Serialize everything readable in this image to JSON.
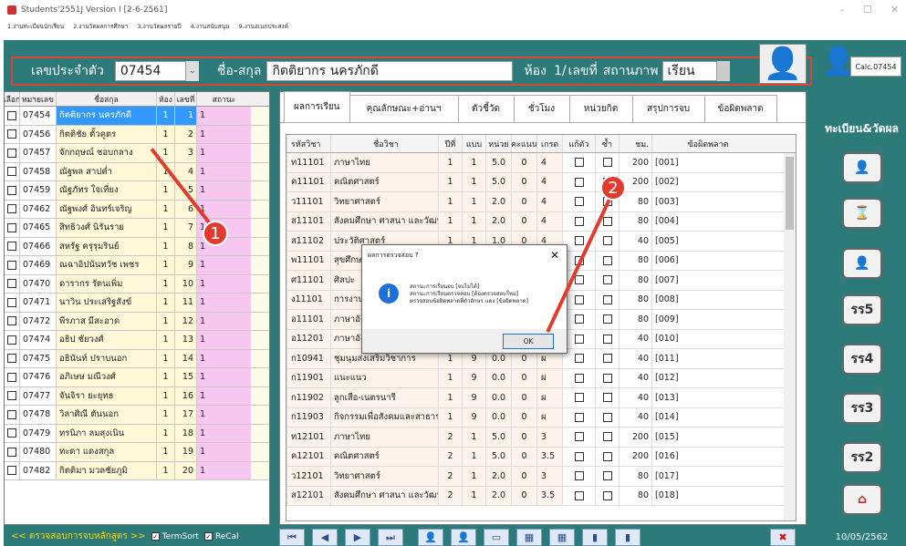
{
  "window": {
    "title": "Students'2551J Version I [2-6-2561]"
  },
  "menu": [
    "1.งานทะเบียนนักเรียน",
    "2.งานวัดผลการศึกษา",
    "3.งานวัดผลรายปี",
    "4.งานสนับสนุน",
    "9.งานอเนกประสงค์"
  ],
  "header": {
    "id_label": "เลขประจำตัว",
    "id_value": "07454",
    "name_label": "ชื่อ-สกุล",
    "name_value": "กิตติยากร นครภักดี",
    "room_label": "ห้อง",
    "room_value": "1/",
    "no_label": "เลขที่",
    "status_label": "สถานภาพ",
    "status_value": "เรียน"
  },
  "right": {
    "calc_label": "Calc.07454",
    "section_title": "ทะเบียน&วัดผล",
    "buttons": [
      "รร5",
      "รร4",
      "รร3",
      "รร2"
    ],
    "date": "10/05/2562"
  },
  "left_grid": {
    "headers": [
      "เลือก",
      "หมายเลข",
      "ชื่อสกุล",
      "ห้อง",
      "เลขที่",
      "สถานะ"
    ],
    "rows": [
      {
        "id": "07454",
        "name": "กิตติยากร นครภักดี",
        "room": "1",
        "no": "1",
        "status": "1"
      },
      {
        "id": "07456",
        "name": "กิตติชัย ตั้วคูตร",
        "room": "1",
        "no": "2",
        "status": "1"
      },
      {
        "id": "07457",
        "name": "จักกฤษณ์ ชอบกลาง",
        "room": "1",
        "no": "3",
        "status": "1"
      },
      {
        "id": "07458",
        "name": "ณัฐพล สาปค่ำ",
        "room": "1",
        "no": "4",
        "status": "1"
      },
      {
        "id": "07459",
        "name": "ณัฐภัทร ใจเที่ยง",
        "room": "1",
        "no": "5",
        "status": "1"
      },
      {
        "id": "07462",
        "name": "ณัฐพงศ์ อินทร์เจริญ",
        "room": "1",
        "no": "6",
        "status": "1"
      },
      {
        "id": "07465",
        "name": "สิทธิวงศ์ นิรันราย",
        "room": "1",
        "no": "7",
        "status": "1"
      },
      {
        "id": "07466",
        "name": "สหรัฐ ครุรุมรินย์",
        "room": "1",
        "no": "8",
        "status": "1"
      },
      {
        "id": "07469",
        "name": "ณฉาอิปนันทวัช เพชร",
        "room": "1",
        "no": "9",
        "status": "1"
      },
      {
        "id": "07470",
        "name": "ดารากร รัตนเพิ่ม",
        "room": "1",
        "no": "10",
        "status": "1"
      },
      {
        "id": "07471",
        "name": "นาวิน ประเสริฐสังข์",
        "room": "1",
        "no": "11",
        "status": "1"
      },
      {
        "id": "07472",
        "name": "พีรภาส มีสะอาด",
        "room": "1",
        "no": "12",
        "status": "1"
      },
      {
        "id": "07474",
        "name": "อธิป ชัยวงศ์",
        "room": "1",
        "no": "13",
        "status": "1"
      },
      {
        "id": "07475",
        "name": "อธินันท์ ปราบนอก",
        "room": "1",
        "no": "14",
        "status": "1"
      },
      {
        "id": "07476",
        "name": "อภิเษษ มณีวงศ์",
        "room": "1",
        "no": "15",
        "status": "1"
      },
      {
        "id": "07477",
        "name": "จันจิรา ยะยุทธ",
        "room": "1",
        "no": "16",
        "status": "1"
      },
      {
        "id": "07478",
        "name": "วิลาศิณี ตันนอก",
        "room": "1",
        "no": "17",
        "status": "1"
      },
      {
        "id": "07479",
        "name": "ทรนิภา ลมสุงเนิน",
        "room": "1",
        "no": "18",
        "status": "1"
      },
      {
        "id": "07480",
        "name": "ทะดา แดงสกุล",
        "room": "1",
        "no": "19",
        "status": "1"
      },
      {
        "id": "07482",
        "name": "กิตติมา มวลชัยภูมิ",
        "room": "1",
        "no": "20",
        "status": "1"
      }
    ]
  },
  "tabs": [
    "ผลการเรียน",
    "คุณลักษณะ+อ่านฯ",
    "ตัวชี้วัด",
    "ชั่วโมง",
    "หน่วยกิต",
    "สรุปการจบ",
    "ข้อผิดพลาด"
  ],
  "grid": {
    "headers": [
      "รหัสวิชา",
      "ชื่อวิชา",
      "ปีที่",
      "แบบ",
      "หน่วย",
      "คะแนน",
      "เกรด",
      "แก้ตัว",
      "ซ้ำ",
      "ชม.",
      "ข้อผิดพลาด"
    ],
    "rows": [
      {
        "code": "ท11101",
        "name": "ภาษาไทย",
        "yr": "1",
        "type": "1",
        "unit": "5.0",
        "score": "0",
        "grade": "4",
        "hrs": "200",
        "err": "[001]"
      },
      {
        "code": "ค11101",
        "name": "คณิตศาสตร์",
        "yr": "1",
        "type": "1",
        "unit": "5.0",
        "score": "0",
        "grade": "4",
        "hrs": "200",
        "err": "[002]"
      },
      {
        "code": "ว11101",
        "name": "วิทยาศาสตร์",
        "yr": "1",
        "type": "1",
        "unit": "2.0",
        "score": "0",
        "grade": "4",
        "hrs": "80",
        "err": "[003]"
      },
      {
        "code": "ส11101",
        "name": "สังคมศึกษา ศาสนา และวัฒนธ",
        "yr": "1",
        "type": "1",
        "unit": "2.0",
        "score": "0",
        "grade": "4",
        "hrs": "80",
        "err": "[004]"
      },
      {
        "code": "ส11102",
        "name": "ประวัติศาสตร์",
        "yr": "1",
        "type": "1",
        "unit": "1.0",
        "score": "0",
        "grade": "4",
        "hrs": "40",
        "err": "[005]"
      },
      {
        "code": "พ11101",
        "name": "สุขศึกษาและพลศึกษา",
        "yr": "1",
        "type": "1",
        "unit": "2.0",
        "score": "0",
        "grade": "4",
        "hrs": "80",
        "err": "[006]"
      },
      {
        "code": "ศ11101",
        "name": "ศิลปะ",
        "yr": "1",
        "type": "1",
        "unit": "2.0",
        "score": "0",
        "grade": "4",
        "hrs": "80",
        "err": "[007]"
      },
      {
        "code": "ง11101",
        "name": "การงานอาชีพ",
        "yr": "1",
        "type": "1",
        "unit": "2.0",
        "score": "0",
        "grade": "4",
        "hrs": "80",
        "err": "[008]"
      },
      {
        "code": "อ11101",
        "name": "ภาษาอังกฤษ",
        "yr": "1",
        "type": "1",
        "unit": "2.0",
        "score": "0",
        "grade": "3.5",
        "hrs": "80",
        "err": "[009]"
      },
      {
        "code": "อ11201",
        "name": "ภาษาอังกฤษเพิ่มเติม",
        "yr": "1",
        "type": "2",
        "unit": "1.0",
        "score": "0",
        "grade": "4",
        "hrs": "40",
        "err": "[010]"
      },
      {
        "code": "ก10941",
        "name": "ชุมนุมส่งเสริมวิชาการ",
        "yr": "1",
        "type": "9",
        "unit": "0.0",
        "score": "0",
        "grade": "ผ",
        "hrs": "40",
        "err": "[011]"
      },
      {
        "code": "ก11901",
        "name": "แนะแนว",
        "yr": "1",
        "type": "9",
        "unit": "0.0",
        "score": "0",
        "grade": "ผ",
        "hrs": "40",
        "err": "[012]"
      },
      {
        "code": "ก11902",
        "name": "ลูกเสือ-เนตรนารี",
        "yr": "1",
        "type": "9",
        "unit": "0.0",
        "score": "0",
        "grade": "ผ",
        "hrs": "40",
        "err": "[013]"
      },
      {
        "code": "ก11903",
        "name": "กิจกรรมเพื่อสังคมและสาธารณ",
        "yr": "1",
        "type": "9",
        "unit": "0.0",
        "score": "0",
        "grade": "ผ",
        "hrs": "40",
        "err": "[014]"
      },
      {
        "code": "ท12101",
        "name": "ภาษาไทย",
        "yr": "2",
        "type": "1",
        "unit": "5.0",
        "score": "0",
        "grade": "3",
        "hrs": "200",
        "err": "[015]"
      },
      {
        "code": "ค12101",
        "name": "คณิตศาสตร์",
        "yr": "2",
        "type": "1",
        "unit": "5.0",
        "score": "0",
        "grade": "3.5",
        "hrs": "200",
        "err": "[016]"
      },
      {
        "code": "ว12101",
        "name": "วิทยาศาสตร์",
        "yr": "2",
        "type": "1",
        "unit": "2.0",
        "score": "0",
        "grade": "3",
        "hrs": "80",
        "err": "[017]"
      },
      {
        "code": "ส12101",
        "name": "สังคมศึกษา ศาสนา และวัฒนธ",
        "yr": "2",
        "type": "1",
        "unit": "2.0",
        "score": "0",
        "grade": "3.5",
        "hrs": "80",
        "err": "[018]"
      }
    ]
  },
  "dialog": {
    "title": "ผลการตรวจสอบ ?",
    "line1": "สถานะการเรียนจบ [จบไม่ได้]",
    "line2": "สถานะการเรียนตรวจสอบ [ต้องตรวจสอบใหม่]",
    "line3": "ตรวจสอบข้อผิดพลาดที่ตัวอักษร แดง [ข้อผิดพลาด]",
    "ok": "OK"
  },
  "footer": {
    "check_label": "<< ตรวจสอบการจบหลักสูตร >>",
    "termsort": "TermSort",
    "recal": "ReCal"
  },
  "markers": [
    "1",
    "2"
  ]
}
